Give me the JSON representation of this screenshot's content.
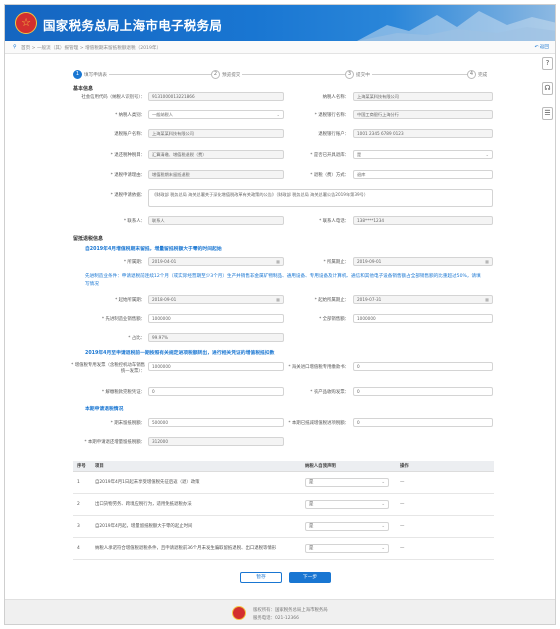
{
  "header": {
    "title": "国家税务总局上海市电子税务局",
    "emblem_icon": "tax-emblem-icon"
  },
  "breadcrumb": {
    "path": "首页 > 一般流（其）报管理 > 增值税期末留抵税额退税（2019年）",
    "back_label": "返回"
  },
  "tools": [
    "help-icon",
    "message-icon",
    "document-icon"
  ],
  "steps": [
    {
      "num": "1",
      "label": "填写申请表"
    },
    {
      "num": "2",
      "label": "预览提交"
    },
    {
      "num": "3",
      "label": "提交中"
    },
    {
      "num": "4",
      "label": "完成"
    }
  ],
  "basic": {
    "title": "基本信息",
    "tax_id_label": "社会信用代码（纳税人识别号）：",
    "tax_id_value": "9131000013221866",
    "name_label": "纳税人名称：",
    "name_value": "上海某某科技有限公司",
    "bank_label": "* 纳税人类别：",
    "bank_value": "一般纳税人",
    "contact_label": "* 退税银行名称：",
    "contact_value": "中国工商银行上海分行",
    "account_label": "退税账户名称：",
    "account_value": "上海某某科技有限公司",
    "acct_no_label": "退税银行账户：",
    "acct_no_value": "1001 2345 6789 0123",
    "tax_type_label": "* 退还税种税目：",
    "tax_type_value": "汇算清缴、增值税退税（费）",
    "qualify_label": "* 是否已开具退库：",
    "qualify_value": "是",
    "reason_label": "* 退税申请理由：",
    "reason_value": "增值税期末留抵退税",
    "method_label": "* 退税（费）方式：",
    "method_value": "退库",
    "basis_label": "* 退税申请依据：",
    "basis_value": "《财政部 税务总局 海关总署关于深化增值税改革有关政策的公告》（财政部 税务总局 海关总署公告2019年第39号）",
    "person_label": "* 联系人：",
    "person_value": "联系人",
    "phone_label": "* 联系人电话：",
    "phone_value": "138****1234"
  },
  "refund": {
    "title": "留抵退税信息",
    "sub1": "自2019年4月增值税期末留抵，增量留抵税额大于零的时间起始",
    "start_label": "* 所属期：",
    "start_value": "2019-04-01",
    "end_label": "* 所属期止：",
    "end_value": "2019-09-01",
    "note": "先进制造业条件：申请退税前连续12个月（或实际经营期至少3个月）生产并销售非金属矿物制品、通用设备、专用设备及计算机、通信和其他电子设备销售额占全部销售额的比重超过50%，请填写情况",
    "sales_start_label": "* 起始所属期：",
    "sales_start_value": "2018-09-01",
    "sales_end_label": "* 起始所属期止：",
    "sales_end_value": "2019-07-31",
    "sales_label": "* 先进制造业销售额：",
    "sales_value": "1000000",
    "total_label": "* 全部销售额：",
    "total_value": "1000000",
    "ratio_label": "* 占比：",
    "ratio_value": "99.97%",
    "sub2": "2019年4月至申请退税前一期按照有关规定进项税额转出，进行相关凭证的增值税抵扣数",
    "a_label": "* 增值税专用发票（含税控机动车销售统一发票）：",
    "a_value": "1000000",
    "b_label": "* 海关进口增值税专用缴款书：",
    "b_value": "0",
    "c_label": "* 解缴税款完税凭证：",
    "c_value": "0",
    "d_label": "* 农产品收购发票：",
    "d_value": "0",
    "sub3": "本期申请退税情况",
    "e_label": "* 期末留抵税额：",
    "e_value": "500000",
    "f_label": "* 本期已抵减增值税进项税额：",
    "f_value": "0",
    "g_label": "* 本期申请退还增量留抵税额：",
    "g_value": "312000"
  },
  "table": {
    "headers": [
      "序号",
      "项目",
      "纳税人自我声明",
      "操作"
    ],
    "rows": [
      {
        "no": "1",
        "item": "自2019年4月1日起未享受增值税先征后返（退）政策",
        "value": "是",
        "op": "—"
      },
      {
        "no": "2",
        "item": "出口货物劳务、跨境应税行为，适用免抵退税办法",
        "value": "是",
        "op": "—"
      },
      {
        "no": "3",
        "item": "自2019年4月起，增量留抵税额大于零的起止时间",
        "value": "是",
        "op": "—"
      },
      {
        "no": "4",
        "item": "纳税人承诺符合增值税退税条件，且申请退税前36个月未发生骗取留抵退税、出口退税等情形",
        "value": "是",
        "op": "—"
      }
    ]
  },
  "buttons": {
    "prev": "暂存",
    "next": "下一步"
  },
  "footer": {
    "line1": "版权所有：国家税务总局上海市税务局",
    "line2": "服务电话：021-12366"
  },
  "colors": {
    "brand": "#1976d2",
    "header": "#1565c0"
  }
}
